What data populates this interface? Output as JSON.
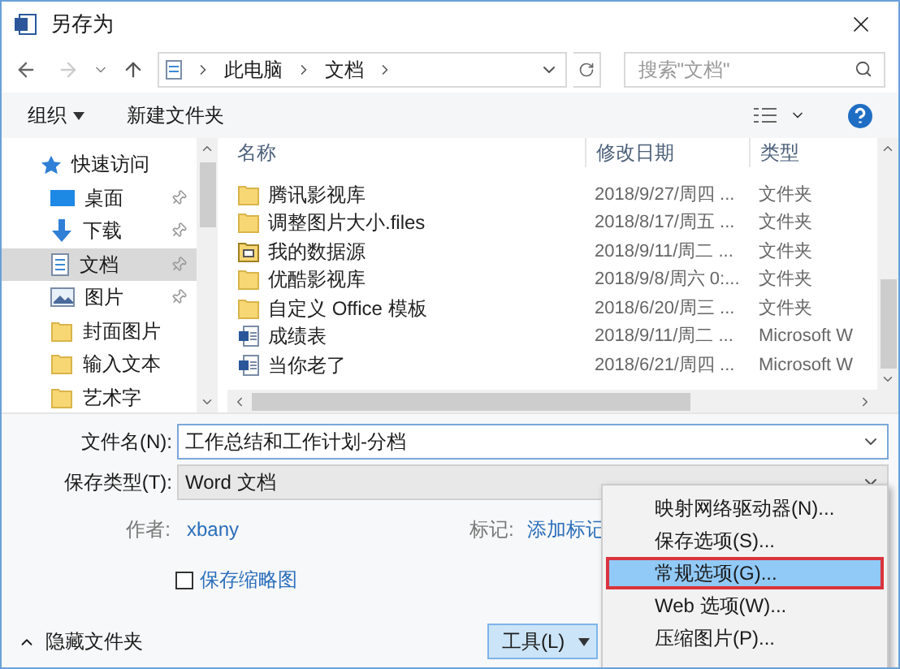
{
  "window": {
    "title": "另存为"
  },
  "address": {
    "path": [
      {
        "label": "此电脑"
      },
      {
        "label": "文档"
      }
    ],
    "search_placeholder": "搜索\"文档\""
  },
  "toolbar": {
    "organize": "组织",
    "new_folder": "新建文件夹"
  },
  "nav": [
    {
      "label": "快速访问",
      "kind": "star",
      "pinned": false,
      "selected": false
    },
    {
      "label": "桌面",
      "kind": "desktop",
      "pinned": true,
      "selected": false
    },
    {
      "label": "下载",
      "kind": "download",
      "pinned": true,
      "selected": false
    },
    {
      "label": "文档",
      "kind": "document",
      "pinned": true,
      "selected": true
    },
    {
      "label": "图片",
      "kind": "pictures",
      "pinned": true,
      "selected": false
    },
    {
      "label": "封面图片",
      "kind": "folder",
      "pinned": false,
      "selected": false
    },
    {
      "label": "输入文本",
      "kind": "folder",
      "pinned": false,
      "selected": false
    },
    {
      "label": "艺术字",
      "kind": "folder",
      "pinned": false,
      "selected": false
    }
  ],
  "table": {
    "columns": [
      "名称",
      "修改日期",
      "类型"
    ],
    "rows": [
      {
        "name": "腾讯影视库",
        "date": "2018/9/27/周四 ...",
        "type": "文件夹",
        "kind": "folder"
      },
      {
        "name": "调整图片大小.files",
        "date": "2018/8/17/周五 ...",
        "type": "文件夹",
        "kind": "folder"
      },
      {
        "name": "我的数据源",
        "date": "2018/9/11/周二 ...",
        "type": "文件夹",
        "kind": "datasource"
      },
      {
        "name": "优酷影视库",
        "date": "2018/9/8/周六 0:...",
        "type": "文件夹",
        "kind": "folder"
      },
      {
        "name": "自定义 Office 模板",
        "date": "2018/6/20/周三 ...",
        "type": "文件夹",
        "kind": "folder"
      },
      {
        "name": "成绩表",
        "date": "2018/9/11/周二 ...",
        "type": "Microsoft W",
        "kind": "word"
      },
      {
        "name": "当你老了",
        "date": "2018/6/21/周四 ...",
        "type": "Microsoft W",
        "kind": "word"
      }
    ]
  },
  "form": {
    "filename_label": "文件名(N):",
    "filename": "工作总结和工作计划-分档",
    "type_label": "保存类型(T):",
    "type": "Word 文档",
    "author_label": "作者:",
    "author": "xbany",
    "tags_label": "标记:",
    "tags": "添加标记",
    "thumbnail": {
      "label": "保存缩略图",
      "checked": false
    }
  },
  "footer": {
    "hide_folders": "隐藏文件夹",
    "tools": "工具(L)"
  },
  "menu": [
    {
      "label": "映射网络驱动器(N)...",
      "selected": false
    },
    {
      "label": "保存选项(S)...",
      "selected": false
    },
    {
      "label": "常规选项(G)...",
      "selected": true
    },
    {
      "label": "Web 选项(W)...",
      "selected": false
    },
    {
      "label": "压缩图片(P)...",
      "selected": false
    }
  ]
}
